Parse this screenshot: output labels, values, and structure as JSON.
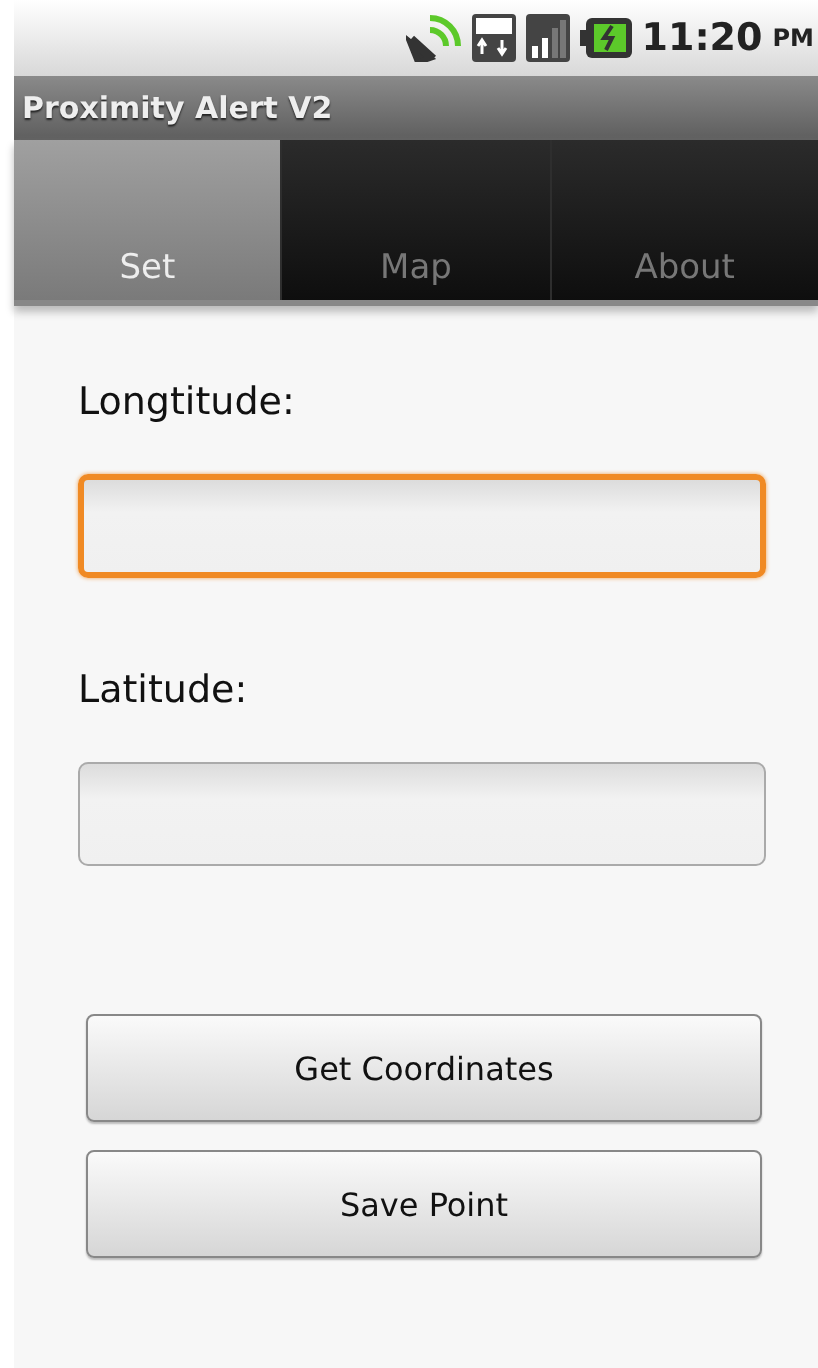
{
  "status_bar": {
    "time": "11:20",
    "period": "PM"
  },
  "window": {
    "title": "Proximity Alert V2"
  },
  "tabs": [
    {
      "label": "Set",
      "selected": true
    },
    {
      "label": "Map",
      "selected": false
    },
    {
      "label": "About",
      "selected": false
    }
  ],
  "fields": [
    {
      "label": "Longtitude:",
      "focused": true
    },
    {
      "label": "Latitude:",
      "focused": false
    }
  ],
  "buttons": [
    "Get Coordinates",
    "Save Point"
  ]
}
